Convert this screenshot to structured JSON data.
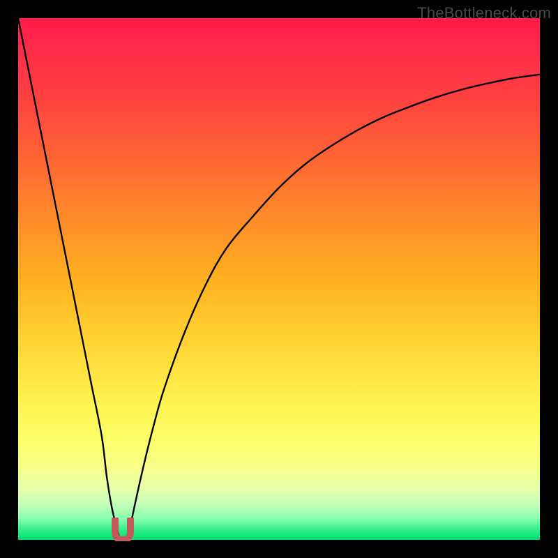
{
  "watermark": "TheBottleneck.com",
  "colors": {
    "frame": "#000000",
    "curve": "#000000",
    "hook": "#c15a5a",
    "gradient_top": "#ff1a4a",
    "gradient_bottom": "#00dd72"
  },
  "chart_data": {
    "type": "line",
    "title": "",
    "xlabel": "",
    "ylabel": "",
    "xlim": [
      0,
      100
    ],
    "ylim": [
      0,
      100
    ],
    "grid": false,
    "series": [
      {
        "name": "left-branch",
        "x": [
          0,
          2,
          4,
          6,
          8,
          10,
          12,
          14,
          16,
          17,
          18,
          19,
          19.5
        ],
        "values": [
          100,
          90,
          80,
          70,
          60,
          50,
          40,
          30,
          20,
          12,
          6,
          2,
          0
        ]
      },
      {
        "name": "right-branch",
        "x": [
          21,
          22,
          24,
          26,
          28,
          32,
          36,
          40,
          45,
          50,
          55,
          60,
          65,
          70,
          75,
          80,
          85,
          90,
          95,
          100
        ],
        "values": [
          0,
          5,
          14,
          22,
          29,
          40,
          49,
          56,
          62,
          67.5,
          72,
          75.5,
          78.5,
          81,
          83,
          84.8,
          86.3,
          87.5,
          88.5,
          89.2
        ]
      }
    ],
    "annotations": [
      {
        "name": "valley-hook",
        "x": 20,
        "y": 0,
        "shape": "u-hook",
        "color": "#c15a5a"
      }
    ]
  }
}
